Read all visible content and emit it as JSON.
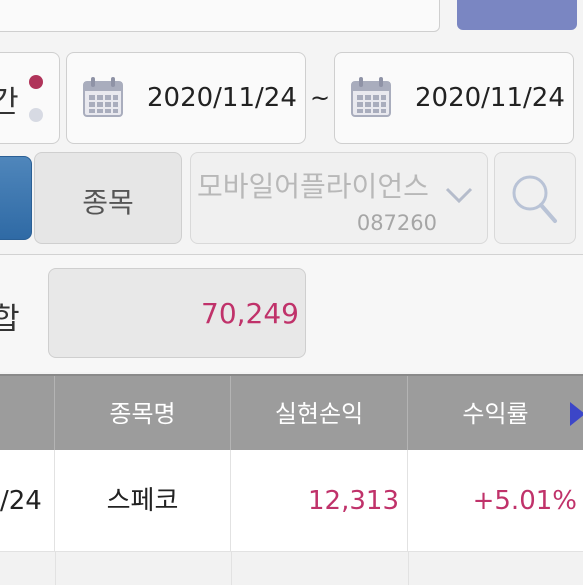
{
  "period": {
    "radio_label": "간",
    "from_date": "2020/11/24",
    "separator": "~",
    "to_date": "2020/11/24",
    "calendar_icon": "calendar-icon"
  },
  "search": {
    "type_label": "종목",
    "stock_name": "모바일어플라이언스",
    "stock_code": "087260",
    "search_icon": "search-icon"
  },
  "summary": {
    "label": "합",
    "value": "70,249"
  },
  "table": {
    "headers": [
      "",
      "종목명",
      "실현손익",
      "수익률"
    ],
    "rows": [
      {
        "date": "/24",
        "name": "스페코",
        "profit": "12,313",
        "rate": "+5.01%"
      }
    ]
  },
  "colors": {
    "accent_blue": "#2f6aa5",
    "profit_red": "#c0326a",
    "header_gray": "#9c9c9c",
    "arrow_blue": "#3c46c8"
  }
}
